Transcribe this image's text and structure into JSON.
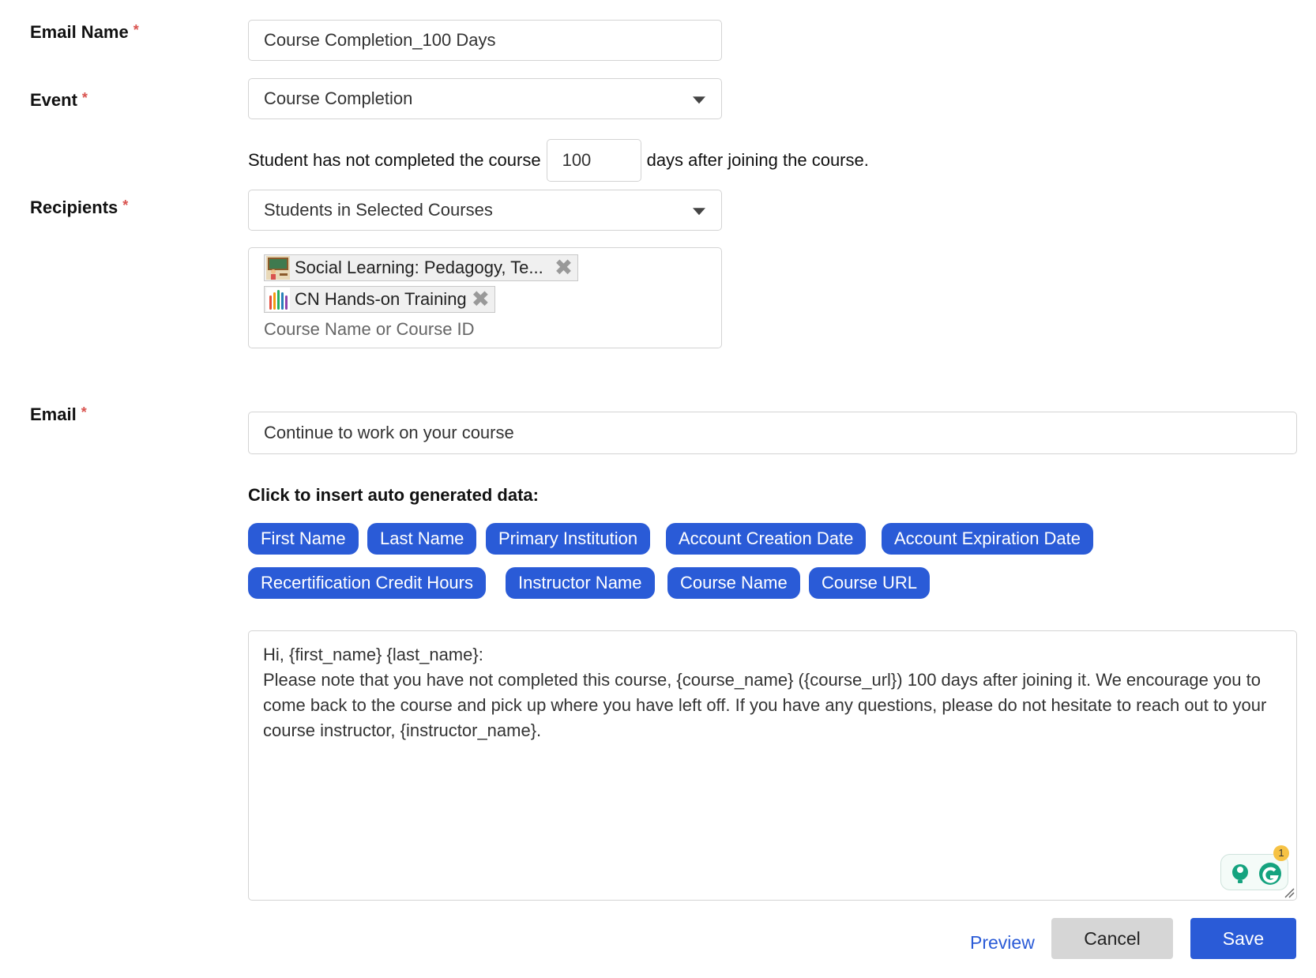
{
  "form": {
    "email_name": {
      "label": "Email Name",
      "required_mark": "*",
      "value": "Course Completion_100 Days"
    },
    "event": {
      "label": "Event",
      "required_mark": "*",
      "selected": "Course Completion"
    },
    "condition": {
      "prefix": "Student has not completed the course",
      "days": "100",
      "suffix": "days after joining the course."
    },
    "recipients": {
      "label": "Recipients",
      "required_mark": "*",
      "selected": "Students in Selected Courses",
      "chips": [
        {
          "label": "Social Learning: Pedagogy, Te...",
          "icon": "classroom-thumbnail-icon"
        },
        {
          "label": "CN Hands-on Training",
          "icon": "hands-thumbnail-icon"
        }
      ],
      "placeholder": "Course Name or Course ID"
    },
    "email": {
      "label": "Email",
      "required_mark": "*",
      "subject": "Continue to work on your course"
    }
  },
  "insert": {
    "title": "Click to insert auto generated data:",
    "tags": [
      "First Name",
      "Last Name",
      "Primary Institution",
      "Account Creation Date",
      "Account Expiration Date",
      "Recertification Credit Hours",
      "Instructor Name",
      "Course Name",
      "Course URL"
    ]
  },
  "body": {
    "line1": "Hi, {first_name} {last_name}:",
    "line2": "Please note that you have not completed this course, {course_name} ({course_url}) 100 days after joining it. We encourage you to come back to the course and pick up where you have left off. If you have any questions, please do not hesitate to reach out to your course instructor, {instructor_name}."
  },
  "grammarly": {
    "badge_count": "1"
  },
  "actions": {
    "preview": "Preview",
    "cancel": "Cancel",
    "save": "Save"
  },
  "colors": {
    "accent": "#2a5bd7",
    "required": "#d9534f"
  }
}
